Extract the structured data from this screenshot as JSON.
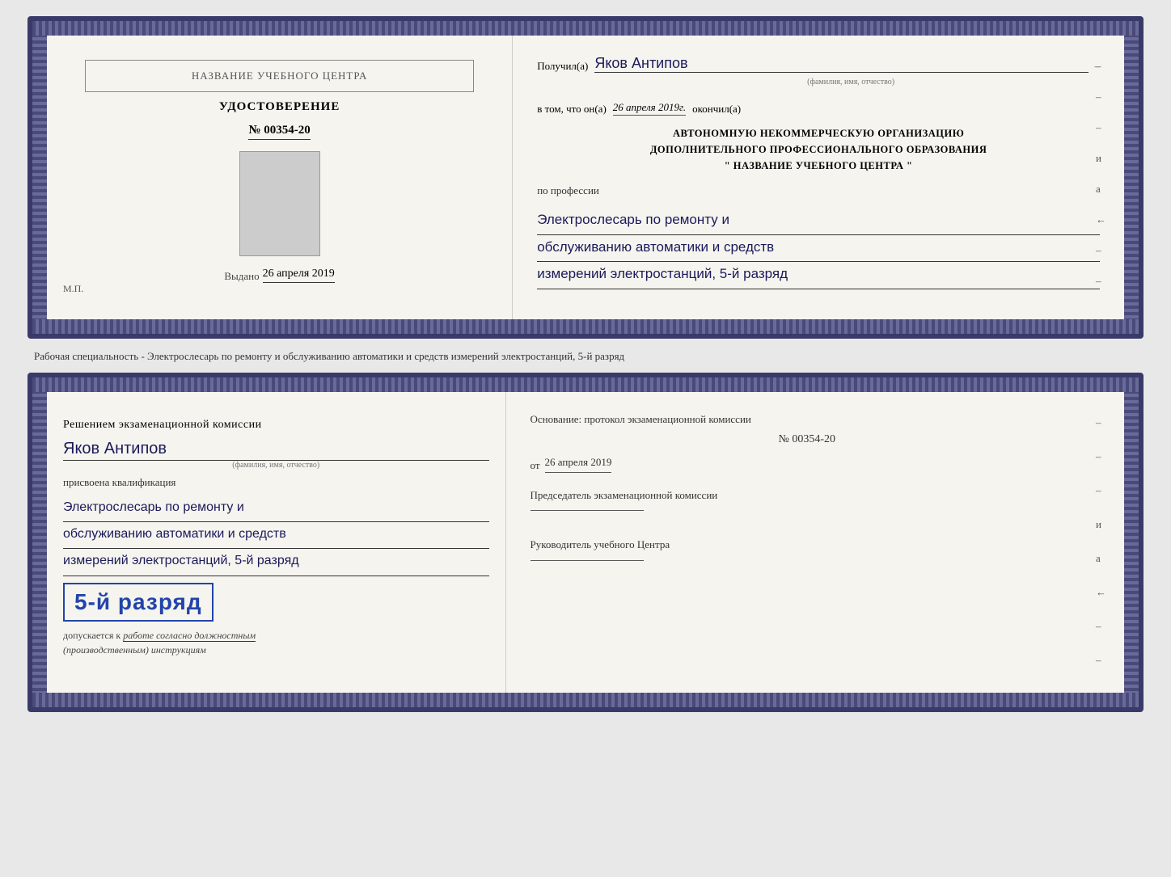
{
  "top_doc": {
    "left": {
      "school_name": "НАЗВАНИЕ УЧЕБНОГО ЦЕНТРА",
      "cert_title": "УДОСТОВЕРЕНИЕ",
      "cert_number": "№ 00354-20",
      "issued_label": "Выдано",
      "issued_date": "26 апреля 2019",
      "stamp": "М.П."
    },
    "right": {
      "recipient_prefix": "Получил(а)",
      "recipient_name": "Яков Антипов",
      "recipient_sublabel": "(фамилия, имя, отчество)",
      "confirm_prefix": "в том, что он(а)",
      "confirm_date": "26 апреля 2019г.",
      "confirm_suffix": "окончил(а)",
      "org_line1": "АВТОНОМНУЮ НЕКОММЕРЧЕСКУЮ ОРГАНИЗАЦИЮ",
      "org_line2": "ДОПОЛНИТЕЛЬНОГО ПРОФЕССИОНАЛЬНОГО ОБРАЗОВАНИЯ",
      "org_line3": "\" НАЗВАНИЕ УЧЕБНОГО ЦЕНТРА \"",
      "profession_label": "по профессии",
      "profession_line1": "Электрослесарь по ремонту и",
      "profession_line2": "обслуживанию автоматики и средств",
      "profession_line3": "измерений электростанций, 5-й разряд",
      "dashes": [
        "-",
        "-",
        "-",
        "и",
        "а",
        "←",
        "-",
        "-",
        "-",
        "-"
      ]
    }
  },
  "between_text": "Рабочая специальность - Электрослесарь по ремонту и обслуживанию автоматики и средств\nизмерений электростанций, 5-й разряд",
  "bottom_doc": {
    "left": {
      "commission_text": "Решением экзаменационной комиссии",
      "person_name": "Яков Антипов",
      "person_sublabel": "(фамилия, имя, отчество)",
      "assigned_label": "присвоена квалификация",
      "qual_line1": "Электрослесарь по ремонту и",
      "qual_line2": "обслуживанию автоматики и средств",
      "qual_line3": "измерений электростанций, 5-й разряд",
      "rank_text": "5-й разряд",
      "допускается_prefix": "допускается к",
      "допускается_text": "работе согласно должностным",
      "инструкции_text": "(производственным) инструкциям"
    },
    "right": {
      "basis_label": "Основание: протокол экзаменационной комиссии",
      "protocol_number": "№ 00354-20",
      "protocol_date_prefix": "от",
      "protocol_date": "26 апреля 2019",
      "chairman_label": "Председатель экзаменационной комиссии",
      "director_label": "Руководитель учебного Центра",
      "dashes": [
        "-",
        "-",
        "-",
        "и",
        "а",
        "←",
        "-",
        "-",
        "-",
        "-"
      ]
    }
  }
}
